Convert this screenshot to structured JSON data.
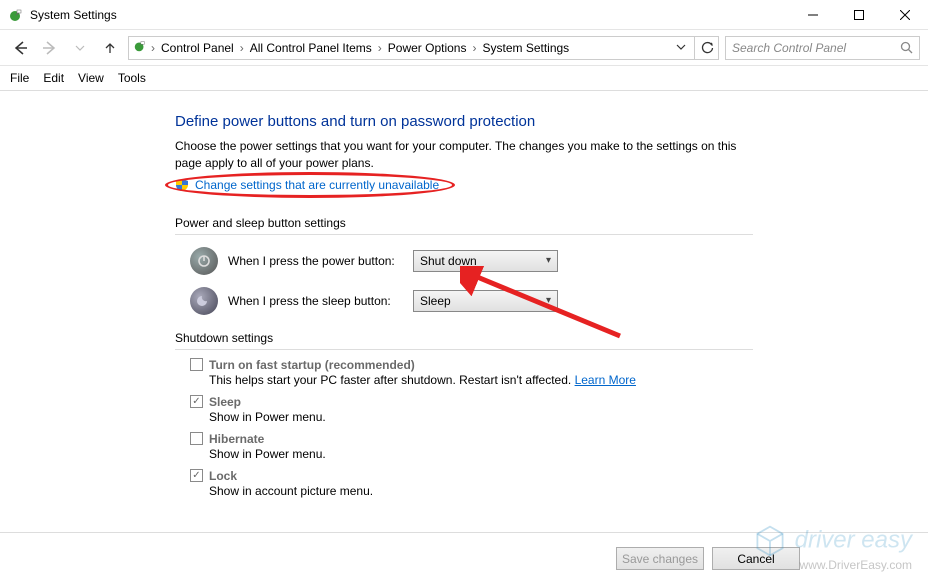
{
  "window": {
    "title": "System Settings"
  },
  "breadcrumbs": [
    "Control Panel",
    "All Control Panel Items",
    "Power Options",
    "System Settings"
  ],
  "search": {
    "placeholder": "Search Control Panel"
  },
  "menu": [
    "File",
    "Edit",
    "View",
    "Tools"
  ],
  "page": {
    "title": "Define power buttons and turn on password protection",
    "description": "Choose the power settings that you want for your computer. The changes you make to the settings on this page apply to all of your power plans.",
    "change_link": "Change settings that are currently unavailable",
    "section_power": "Power and sleep button settings",
    "power_rows": [
      {
        "label": "When I press the power button:",
        "value": "Shut down"
      },
      {
        "label": "When I press the sleep button:",
        "value": "Sleep"
      }
    ],
    "section_shutdown": "Shutdown settings",
    "shutdown_items": [
      {
        "title": "Turn on fast startup (recommended)",
        "sub": "This helps start your PC faster after shutdown. Restart isn't affected.",
        "learn": "Learn More",
        "checked": false
      },
      {
        "title": "Sleep",
        "sub": "Show in Power menu.",
        "checked": true
      },
      {
        "title": "Hibernate",
        "sub": "Show in Power menu.",
        "checked": false
      },
      {
        "title": "Lock",
        "sub": "Show in account picture menu.",
        "checked": true
      }
    ],
    "buttons": {
      "save": "Save changes",
      "cancel": "Cancel"
    }
  },
  "watermark": {
    "big": "driver easy",
    "small": "www.DriverEasy.com"
  }
}
